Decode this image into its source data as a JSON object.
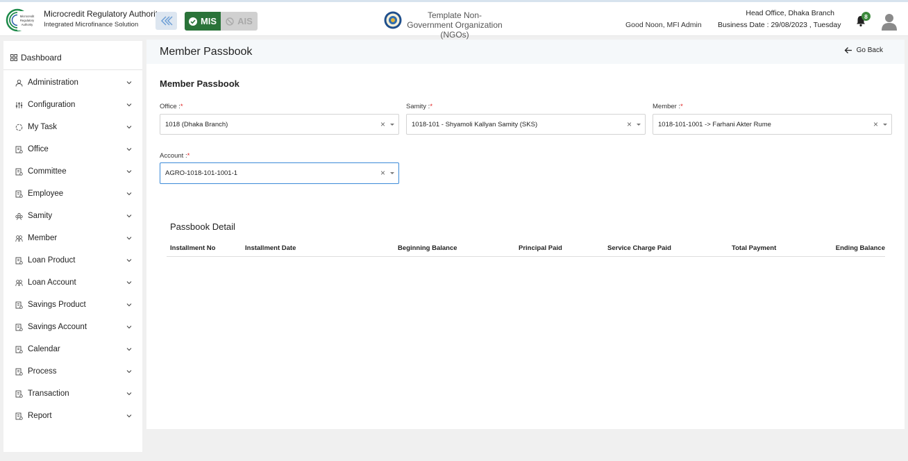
{
  "header": {
    "brand_title": "Microcredit Regulatory Authority",
    "brand_subtitle": "Integrated Microfinance Solution",
    "logo_text": "Microcredit Regulatory Authority",
    "mis_label": "MIS",
    "ais_label": "AIS",
    "org_name": "Template Non-Government Organization (NGOs)",
    "greeting": "Good Noon, MFI Admin",
    "office": "Head Office, Dhaka Branch",
    "business_date": "Business Date : 29/08/2023 , Tuesday",
    "notification_count": "8",
    "colors": {
      "mis_active": "#2a7339",
      "accent": "#3b8ad8"
    }
  },
  "sidebar": {
    "dashboard_label": "Dashboard",
    "items": [
      {
        "label": "Administration",
        "icon": "admin-icon"
      },
      {
        "label": "Configuration",
        "icon": "sliders-icon"
      },
      {
        "label": "My Task",
        "icon": "task-icon"
      },
      {
        "label": "Office",
        "icon": "office-icon"
      },
      {
        "label": "Committee",
        "icon": "committee-icon"
      },
      {
        "label": "Employee",
        "icon": "employee-icon"
      },
      {
        "label": "Samity",
        "icon": "samity-icon"
      },
      {
        "label": "Member",
        "icon": "member-icon"
      },
      {
        "label": "Loan Product",
        "icon": "loan-product-icon"
      },
      {
        "label": "Loan Account",
        "icon": "loan-account-icon"
      },
      {
        "label": "Savings Product",
        "icon": "savings-product-icon"
      },
      {
        "label": "Savings Account",
        "icon": "savings-account-icon"
      },
      {
        "label": "Calendar",
        "icon": "calendar-icon"
      },
      {
        "label": "Process",
        "icon": "process-icon"
      },
      {
        "label": "Transaction",
        "icon": "transaction-icon"
      },
      {
        "label": "Report",
        "icon": "report-icon"
      }
    ]
  },
  "main": {
    "page_title": "Member Passbook",
    "go_back_label": "Go Back",
    "section_title": "Member Passbook",
    "form": {
      "office": {
        "label": "Office :",
        "required": "*",
        "value": "1018 (Dhaka Branch)"
      },
      "samity": {
        "label": "Samity :",
        "required": "*",
        "value": "1018-101 - Shyamoli Kallyan Samity (SKS)"
      },
      "member": {
        "label": "Member :",
        "required": "*",
        "value": "1018-101-1001 -> Farhani Akter Rume"
      },
      "account": {
        "label": "Account :",
        "required": "*",
        "value": "AGRO-1018-101-1001-1"
      },
      "clear_symbol": "×"
    },
    "passbook": {
      "title": "Passbook Detail",
      "columns": [
        "Installment No",
        "Installment Date",
        "Beginning Balance",
        "Principal Paid",
        "Service Charge Paid",
        "Total Payment",
        "Ending Balance"
      ]
    }
  }
}
